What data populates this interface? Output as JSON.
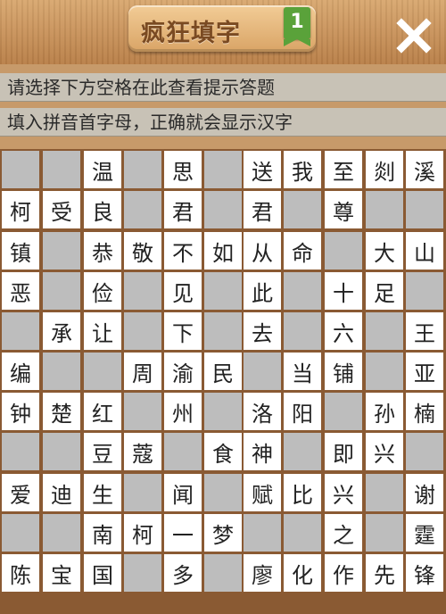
{
  "header": {
    "title": "疯狂填字",
    "level": "1"
  },
  "hints": {
    "line1": "请选择下方空格在此查看提示答题",
    "line2": "填入拼音首字母，正确就会显示汉字"
  },
  "grid": {
    "rows": [
      [
        "",
        "",
        "温",
        "",
        "思",
        "",
        "送",
        "我",
        "至",
        "剡",
        "溪"
      ],
      [
        "柯",
        "受",
        "良",
        "",
        "君",
        "",
        "君",
        "",
        "尊",
        "",
        ""
      ],
      [
        "镇",
        "",
        "恭",
        "敬",
        "不",
        "如",
        "从",
        "命",
        "",
        "大",
        "山"
      ],
      [
        "恶",
        "",
        "俭",
        "",
        "见",
        "",
        "此",
        "",
        "十",
        "足",
        ""
      ],
      [
        "",
        "承",
        "让",
        "",
        "下",
        "",
        "去",
        "",
        "六",
        "",
        "王"
      ],
      [
        "编",
        "",
        "",
        "周",
        "渝",
        "民",
        "",
        "当",
        "铺",
        "",
        "亚"
      ],
      [
        "钟",
        "楚",
        "红",
        "",
        "州",
        "",
        "洛",
        "阳",
        "",
        "孙",
        "楠"
      ],
      [
        "",
        "",
        "豆",
        "蔻",
        "",
        "食",
        "神",
        "",
        "即",
        "兴",
        ""
      ],
      [
        "爱",
        "迪",
        "生",
        "",
        "闻",
        "",
        "赋",
        "比",
        "兴",
        "",
        "谢"
      ],
      [
        "",
        "",
        "南",
        "柯",
        "一",
        "梦",
        "",
        "",
        "之",
        "",
        "霆"
      ],
      [
        "陈",
        "宝",
        "国",
        "",
        "多",
        "",
        "廖",
        "化",
        "作",
        "先",
        "锋"
      ]
    ]
  }
}
